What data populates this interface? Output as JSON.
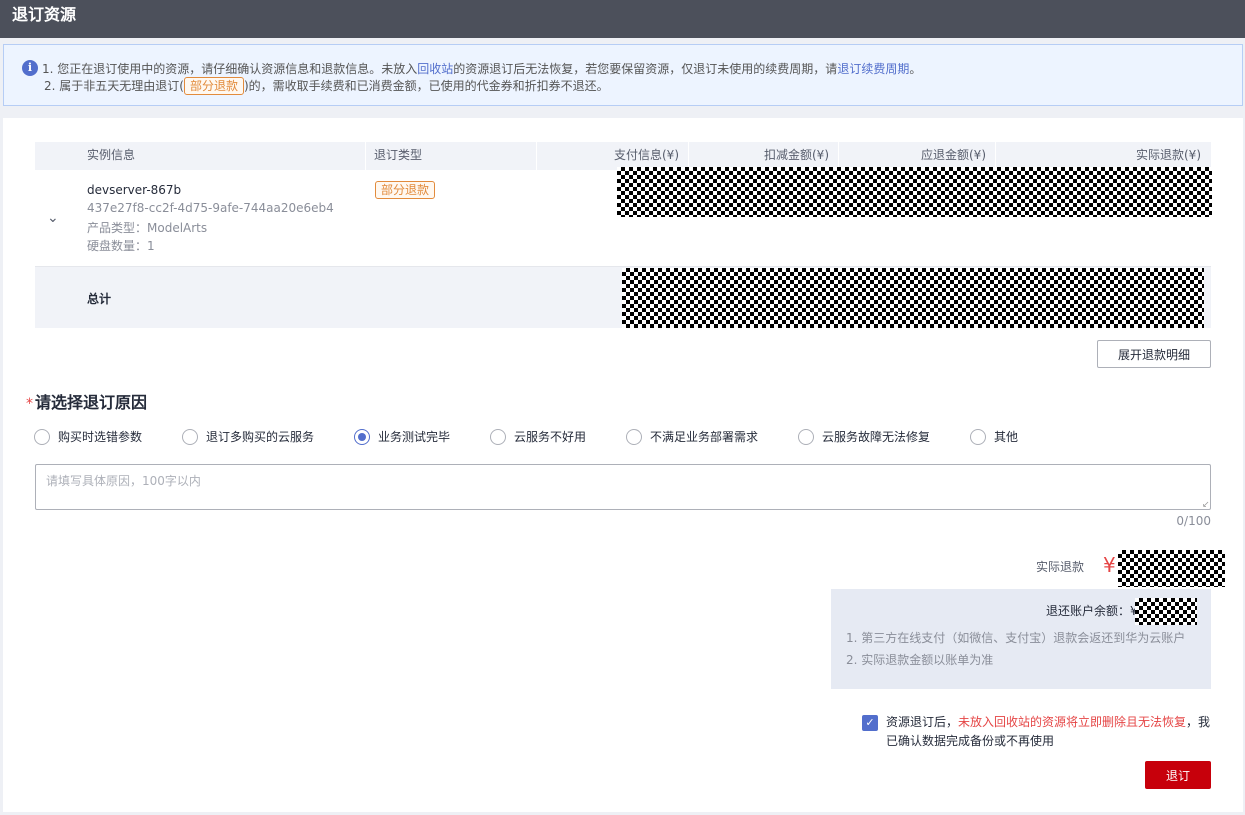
{
  "page": {
    "title": "退订资源"
  },
  "notice": {
    "line1_a": "1. 您正在退订使用中的资源，请仔细确认资源信息和退款信息。未放入",
    "line1_link1": "回收站",
    "line1_b": "的资源退订后无法恢复，若您要保留资源，仅退订未使用的续费周期，请",
    "line1_link2": "退订续费周期",
    "line1_c": "。",
    "line2_a": "2. 属于非五天无理由退订(",
    "line2_tag": "部分退款",
    "line2_b": ")的，需收取手续费和已消费金额，已使用的代金券和折扣券不退还。"
  },
  "table": {
    "headers": [
      "实例信息",
      "退订类型",
      "支付信息(¥)",
      "扣减金额(¥)",
      "应退金额(¥)",
      "实际退款(¥)"
    ],
    "row": {
      "name": "devserver-867b",
      "id": "437e27f8-cc2f-4d75-9afe-744aa20e6eb4",
      "product_type": "产品类型：ModelArts",
      "disk_count": "硬盘数量：1",
      "refund_type": "部分退款"
    },
    "total_label": "总计"
  },
  "expand_button": "展开退款明细",
  "reason": {
    "title": "请选择退订原因",
    "required_mark": "*",
    "options": [
      "购买时选错参数",
      "退订多购买的云服务",
      "业务测试完毕",
      "云服务不好用",
      "不满足业务部署需求",
      "云服务故障无法修复",
      "其他"
    ],
    "selected": "业务测试完毕",
    "placeholder": "请填写具体原因，100字以内",
    "counter": "0/100"
  },
  "refund": {
    "label": "实际退款",
    "currency": "¥",
    "balance_label": "退还账户余额：¥",
    "note1": "1. 第三方在线支付（如微信、支付宝）退款会返还到华为云账户",
    "note2": "2. 实际退款金额以账单为准"
  },
  "confirm": {
    "checked": true,
    "text_a": "资源退订后，",
    "text_warn": "未放入回收站的资源将立即删除且无法恢复",
    "text_b": "，我已确认数据完成备份或不再使用"
  },
  "submit_button": "退订"
}
